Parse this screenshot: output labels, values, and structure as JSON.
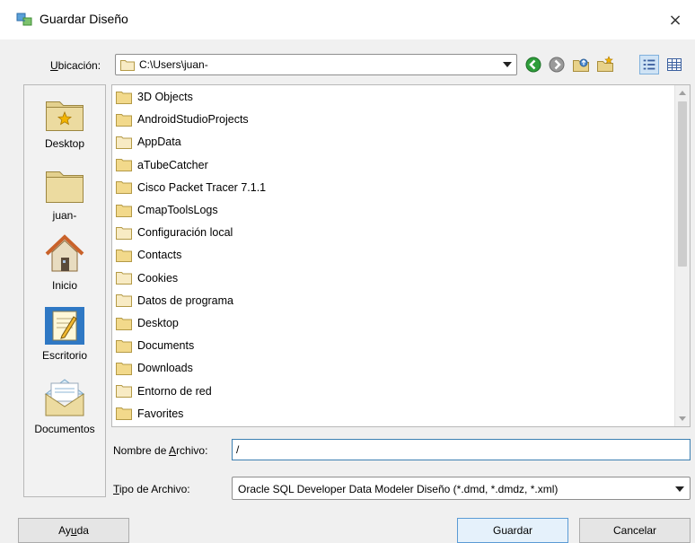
{
  "window": {
    "title": "Guardar Diseño",
    "close_glyph": "×",
    "icon": "datamodeler-app-icon"
  },
  "location": {
    "label_mnemonic": "U",
    "label_rest": "bicación:",
    "value": "C:\\Users\\juan-",
    "toolbar": [
      {
        "name": "back-icon",
        "color": "#2e9e3a"
      },
      {
        "name": "forward-icon",
        "color": "#8a8a8a"
      },
      {
        "name": "up-folder-icon",
        "color": "#d9c27a"
      },
      {
        "name": "new-folder-icon",
        "color": "#d9c27a"
      },
      {
        "name": "list-view-icon",
        "color": "#3a5f9e"
      },
      {
        "name": "details-view-icon",
        "color": "#3a5f9e"
      }
    ]
  },
  "shortcuts": [
    {
      "label": "Desktop",
      "icon": "desktop-folder-icon"
    },
    {
      "label": "juan-",
      "icon": "home-folder-icon"
    },
    {
      "label": "Inicio",
      "icon": "house-icon"
    },
    {
      "label": "Escritorio",
      "icon": "notepad-icon"
    },
    {
      "label": "Documentos",
      "icon": "documents-envelope-icon"
    }
  ],
  "files": [
    {
      "name": "3D Objects",
      "icon": "folder-icon"
    },
    {
      "name": "AndroidStudioProjects",
      "icon": "folder-icon"
    },
    {
      "name": "AppData",
      "icon": "folder-light-icon"
    },
    {
      "name": "aTubeCatcher",
      "icon": "folder-icon"
    },
    {
      "name": "Cisco Packet Tracer 7.1.1",
      "icon": "folder-icon"
    },
    {
      "name": "CmapToolsLogs",
      "icon": "folder-icon"
    },
    {
      "name": "Configuración local",
      "icon": "folder-light-icon"
    },
    {
      "name": "Contacts",
      "icon": "folder-icon"
    },
    {
      "name": "Cookies",
      "icon": "folder-light-icon"
    },
    {
      "name": "Datos de programa",
      "icon": "folder-light-icon"
    },
    {
      "name": "Desktop",
      "icon": "folder-icon"
    },
    {
      "name": "Documents",
      "icon": "folder-icon"
    },
    {
      "name": "Downloads",
      "icon": "folder-icon"
    },
    {
      "name": "Entorno de red",
      "icon": "folder-light-icon"
    },
    {
      "name": "Favorites",
      "icon": "folder-icon"
    }
  ],
  "filename": {
    "label_before": "Nombre de ",
    "label_mnemonic": "A",
    "label_after": "rchivo:",
    "value": "/"
  },
  "filetype": {
    "label_mnemonic": "T",
    "label_rest": "ipo de Archivo:",
    "value": "Oracle SQL Developer Data Modeler Diseño (*.dmd, *.dmdz, *.xml)"
  },
  "buttons": {
    "help_before": "Ay",
    "help_mnemonic": "u",
    "help_after": "da",
    "save": "Guardar",
    "cancel": "Cancelar"
  },
  "colors": {
    "folder_fill": "#f2d98b",
    "folder_stroke": "#b49a46",
    "folder_light_fill": "#f8ebc4",
    "focus_border": "#3c7fb1",
    "default_button_border": "#5b9bd5"
  }
}
